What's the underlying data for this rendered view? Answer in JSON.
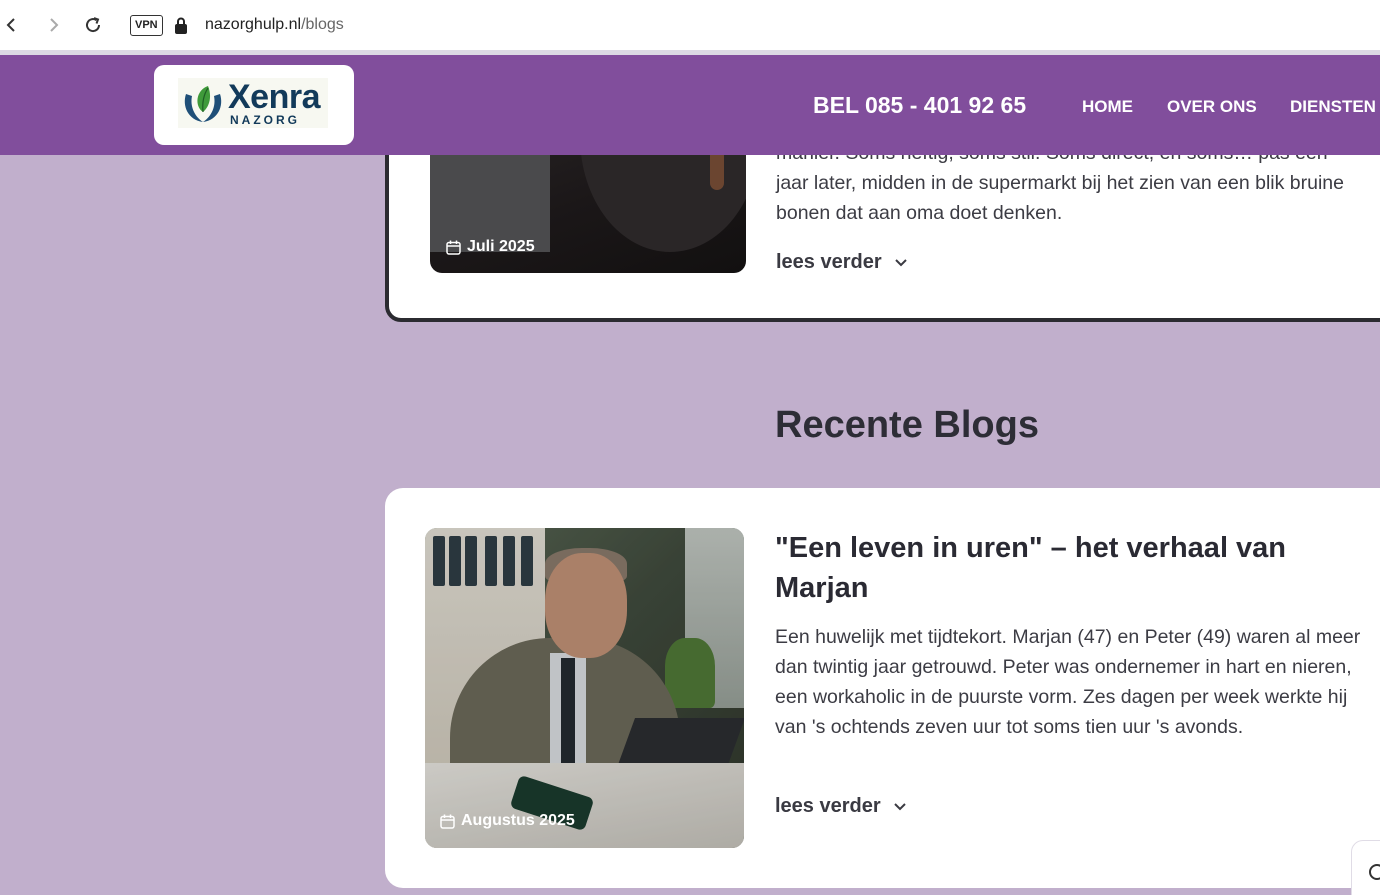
{
  "browser": {
    "vpn_label": "VPN",
    "url_domain": "nazorghulp.nl",
    "url_path": "/blogs"
  },
  "header": {
    "logo_word": "Xenra",
    "logo_sub": "NAZORG",
    "phone": "BEL 085 - 401 92 65",
    "nav": [
      "HOME",
      "OVER ONS",
      "DIENSTEN"
    ]
  },
  "featured": {
    "date": "Juli 2025",
    "text_line_partial": "manier. Soms heftig, soms stil. Soms direct, en soms… pas een",
    "text": "jaar later, midden in de supermarkt bij het zien van een blik bruine bonen dat aan oma doet denken.",
    "read_more": "lees verder"
  },
  "recent": {
    "title": "Recente Blogs",
    "posts": [
      {
        "date": "Augustus 2025",
        "title": "\"Een leven in uren\" – het verhaal van Marjan",
        "excerpt": "Een huwelijk met tijdtekort. Marjan (47) en Peter (49) waren al meer dan twintig jaar getrouwd. Peter was ondernemer in hart en nieren, een workaholic in de puurste vorm. Zes dagen per week werkte hij van 's ochtends zeven uur tot soms tien uur 's avonds.",
        "read_more": "lees verder"
      }
    ]
  },
  "colors": {
    "header_bg": "#814e9c",
    "page_bg": "#c1afcc",
    "logo_blue": "#123a5a"
  }
}
